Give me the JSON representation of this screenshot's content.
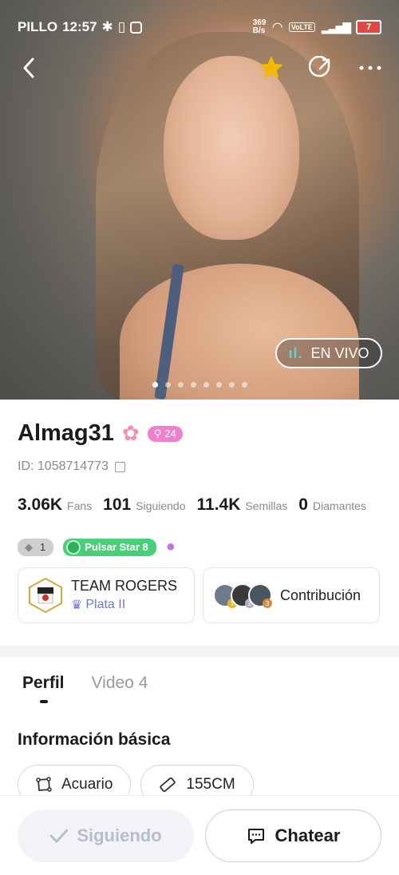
{
  "status_bar": {
    "carrier": "PILLO",
    "time": "12:57",
    "net_speed_top": "369",
    "net_speed_bottom": "B/s",
    "volte": "VoLTE",
    "battery": "7"
  },
  "icons": {
    "back": "chevron-left-icon",
    "favorite": "star-icon",
    "share": "share-icon",
    "more": "more-icon"
  },
  "hero": {
    "live_label": "EN VIVO",
    "live_bars": "ıl.",
    "photo_count": 8,
    "active_photo": 1
  },
  "profile": {
    "name": "Almag31",
    "level": "24",
    "id_text": "ID: 1058714773",
    "stats": [
      {
        "value": "3.06K",
        "label": "Fans"
      },
      {
        "value": "101",
        "label": "Siguiendo"
      },
      {
        "value": "11.4K",
        "label": "Semillas"
      },
      {
        "value": "0",
        "label": "Diamantes"
      }
    ],
    "badges": {
      "diamond_level": "1",
      "pulsar": "Pulsar Star 8"
    }
  },
  "team_card": {
    "name": "TEAM ROGERS",
    "rank": "Plata II"
  },
  "contribution_card": {
    "label": "Contribución",
    "ranks": [
      "1",
      "2",
      "3"
    ]
  },
  "tabs": [
    {
      "label": "Perfil",
      "active": true
    },
    {
      "label": "Video 4",
      "active": false
    }
  ],
  "basic_info": {
    "title": "Información básica",
    "chips": [
      {
        "label": "Acuario",
        "icon": "zodiac-icon"
      },
      {
        "label": "155CM",
        "icon": "ruler-icon"
      }
    ]
  },
  "actions": {
    "follow_label": "Siguiendo",
    "chat_label": "Chatear"
  },
  "colors": {
    "level_badge": "#f07fd0",
    "pulsar_badge": "#49cf7a",
    "live_bars": "#5bd6c8",
    "rank_text": "#6f79c9"
  }
}
